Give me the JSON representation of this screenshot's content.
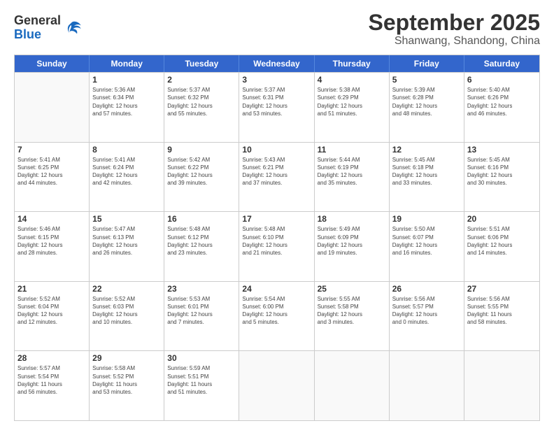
{
  "logo": {
    "general": "General",
    "blue": "Blue"
  },
  "title": "September 2025",
  "subtitle": "Shanwang, Shandong, China",
  "headers": [
    "Sunday",
    "Monday",
    "Tuesday",
    "Wednesday",
    "Thursday",
    "Friday",
    "Saturday"
  ],
  "rows": [
    [
      {
        "day": "",
        "info": ""
      },
      {
        "day": "1",
        "info": "Sunrise: 5:36 AM\nSunset: 6:34 PM\nDaylight: 12 hours\nand 57 minutes."
      },
      {
        "day": "2",
        "info": "Sunrise: 5:37 AM\nSunset: 6:32 PM\nDaylight: 12 hours\nand 55 minutes."
      },
      {
        "day": "3",
        "info": "Sunrise: 5:37 AM\nSunset: 6:31 PM\nDaylight: 12 hours\nand 53 minutes."
      },
      {
        "day": "4",
        "info": "Sunrise: 5:38 AM\nSunset: 6:29 PM\nDaylight: 12 hours\nand 51 minutes."
      },
      {
        "day": "5",
        "info": "Sunrise: 5:39 AM\nSunset: 6:28 PM\nDaylight: 12 hours\nand 48 minutes."
      },
      {
        "day": "6",
        "info": "Sunrise: 5:40 AM\nSunset: 6:26 PM\nDaylight: 12 hours\nand 46 minutes."
      }
    ],
    [
      {
        "day": "7",
        "info": "Sunrise: 5:41 AM\nSunset: 6:25 PM\nDaylight: 12 hours\nand 44 minutes."
      },
      {
        "day": "8",
        "info": "Sunrise: 5:41 AM\nSunset: 6:24 PM\nDaylight: 12 hours\nand 42 minutes."
      },
      {
        "day": "9",
        "info": "Sunrise: 5:42 AM\nSunset: 6:22 PM\nDaylight: 12 hours\nand 39 minutes."
      },
      {
        "day": "10",
        "info": "Sunrise: 5:43 AM\nSunset: 6:21 PM\nDaylight: 12 hours\nand 37 minutes."
      },
      {
        "day": "11",
        "info": "Sunrise: 5:44 AM\nSunset: 6:19 PM\nDaylight: 12 hours\nand 35 minutes."
      },
      {
        "day": "12",
        "info": "Sunrise: 5:45 AM\nSunset: 6:18 PM\nDaylight: 12 hours\nand 33 minutes."
      },
      {
        "day": "13",
        "info": "Sunrise: 5:45 AM\nSunset: 6:16 PM\nDaylight: 12 hours\nand 30 minutes."
      }
    ],
    [
      {
        "day": "14",
        "info": "Sunrise: 5:46 AM\nSunset: 6:15 PM\nDaylight: 12 hours\nand 28 minutes."
      },
      {
        "day": "15",
        "info": "Sunrise: 5:47 AM\nSunset: 6:13 PM\nDaylight: 12 hours\nand 26 minutes."
      },
      {
        "day": "16",
        "info": "Sunrise: 5:48 AM\nSunset: 6:12 PM\nDaylight: 12 hours\nand 23 minutes."
      },
      {
        "day": "17",
        "info": "Sunrise: 5:48 AM\nSunset: 6:10 PM\nDaylight: 12 hours\nand 21 minutes."
      },
      {
        "day": "18",
        "info": "Sunrise: 5:49 AM\nSunset: 6:09 PM\nDaylight: 12 hours\nand 19 minutes."
      },
      {
        "day": "19",
        "info": "Sunrise: 5:50 AM\nSunset: 6:07 PM\nDaylight: 12 hours\nand 16 minutes."
      },
      {
        "day": "20",
        "info": "Sunrise: 5:51 AM\nSunset: 6:06 PM\nDaylight: 12 hours\nand 14 minutes."
      }
    ],
    [
      {
        "day": "21",
        "info": "Sunrise: 5:52 AM\nSunset: 6:04 PM\nDaylight: 12 hours\nand 12 minutes."
      },
      {
        "day": "22",
        "info": "Sunrise: 5:52 AM\nSunset: 6:03 PM\nDaylight: 12 hours\nand 10 minutes."
      },
      {
        "day": "23",
        "info": "Sunrise: 5:53 AM\nSunset: 6:01 PM\nDaylight: 12 hours\nand 7 minutes."
      },
      {
        "day": "24",
        "info": "Sunrise: 5:54 AM\nSunset: 6:00 PM\nDaylight: 12 hours\nand 5 minutes."
      },
      {
        "day": "25",
        "info": "Sunrise: 5:55 AM\nSunset: 5:58 PM\nDaylight: 12 hours\nand 3 minutes."
      },
      {
        "day": "26",
        "info": "Sunrise: 5:56 AM\nSunset: 5:57 PM\nDaylight: 12 hours\nand 0 minutes."
      },
      {
        "day": "27",
        "info": "Sunrise: 5:56 AM\nSunset: 5:55 PM\nDaylight: 11 hours\nand 58 minutes."
      }
    ],
    [
      {
        "day": "28",
        "info": "Sunrise: 5:57 AM\nSunset: 5:54 PM\nDaylight: 11 hours\nand 56 minutes."
      },
      {
        "day": "29",
        "info": "Sunrise: 5:58 AM\nSunset: 5:52 PM\nDaylight: 11 hours\nand 53 minutes."
      },
      {
        "day": "30",
        "info": "Sunrise: 5:59 AM\nSunset: 5:51 PM\nDaylight: 11 hours\nand 51 minutes."
      },
      {
        "day": "",
        "info": ""
      },
      {
        "day": "",
        "info": ""
      },
      {
        "day": "",
        "info": ""
      },
      {
        "day": "",
        "info": ""
      }
    ]
  ]
}
